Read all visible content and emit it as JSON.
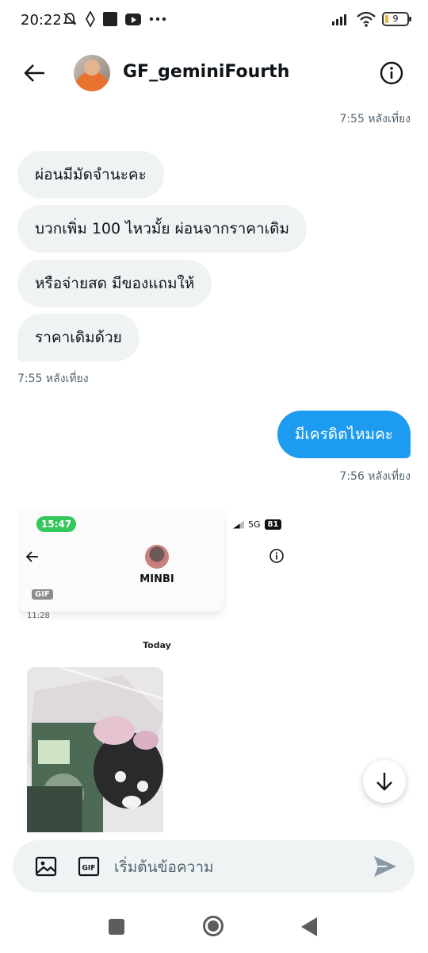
{
  "status_bar": {
    "time": "20:22",
    "battery": "9",
    "icons_left": [
      "dnd-off-icon",
      "sync-icon",
      "app-square-icon",
      "youtube-icon",
      "more-dots-icon"
    ],
    "icons_right": [
      "signal-icon",
      "wifi-icon",
      "battery-icon"
    ]
  },
  "header": {
    "title": "GF_geminiFourth",
    "accent_color": "#1d9bf0"
  },
  "messages": {
    "top_timestamp": "7:55 หลังเที่ยง",
    "incoming": [
      "ผ่อนมีมัดจำนะคะ",
      "บวกเพิ่ม 100 ไหวมั้ย ผ่อนจากราคาเดิม",
      "หรือจ่ายสด มีของแถมให้",
      "ราคาเดิมด้วย"
    ],
    "incoming_timestamp": "7:55 หลังเที่ยง",
    "outgoing": [
      "มีเครดิตไหมคะ"
    ],
    "outgoing_timestamp": "7:56 หลังเที่ยง"
  },
  "embedded_screenshot": {
    "time": "15:47",
    "network": "5G",
    "battery": "81",
    "name": "MINBI",
    "gif_label": "GIF",
    "msg_time": "11:28",
    "divider": "Today"
  },
  "composer": {
    "placeholder": "เริ่มต้นข้อความ",
    "gif_label": "GIF"
  }
}
